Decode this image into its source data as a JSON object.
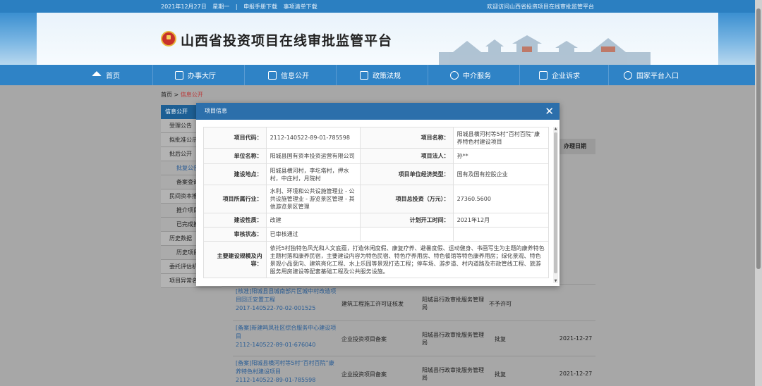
{
  "topbar": {
    "date": "2021年12月27日",
    "weekday": "星期一",
    "separator": "|",
    "manual_download": "申报手册下载",
    "list_download": "事项清单下载",
    "welcome": "欢迎访问山西省投资项目在线审批监管平台"
  },
  "header": {
    "site_title": "山西省投资项目在线审批监管平台"
  },
  "nav": [
    "首页",
    "办事大厅",
    "信息公开",
    "政策法规",
    "中介服务",
    "企业诉求",
    "国家平台入口"
  ],
  "breadcrumb": {
    "home": "首页",
    "arrow": ">",
    "current": "信息公开"
  },
  "sidebar": {
    "head": "信息公开",
    "items": [
      {
        "label": "受理公告",
        "sub": false
      },
      {
        "label": "拟批准公示",
        "sub": false
      },
      {
        "label": "批后公开",
        "sub": false
      },
      {
        "label": "批复公告",
        "sub": true,
        "active": true
      },
      {
        "label": "备案查询",
        "sub": true
      },
      {
        "label": "民间资本推介",
        "sub": false
      },
      {
        "label": "推介项目",
        "sub": true
      },
      {
        "label": "已完成推介",
        "sub": true
      },
      {
        "label": "历史数据",
        "sub": false
      },
      {
        "label": "历史项目",
        "sub": true
      },
      {
        "label": "委托评估机构",
        "sub": false
      },
      {
        "label": "项目异常名录",
        "sub": false
      }
    ]
  },
  "table": {
    "header_date": "办理日期",
    "rows": [
      {
        "name": "[核准]阳城县县城南部片区城中村改造项目回迁安置工程",
        "code": "2017-140522-70-02-001525",
        "matter": "建筑工程施工许可证核发",
        "dept": "阳城县行政审批服务管理局",
        "result": "不予许可",
        "date": ""
      },
      {
        "name": "[备案]新建鸣凤社区综合服务中心建设项目",
        "code": "2112-140522-89-01-676040",
        "matter": "企业投资项目备案",
        "dept": "阳城县行政审批服务管理局",
        "result": "批复",
        "date": "2021-12-27"
      },
      {
        "name": "[备案]阳城县横河村等5村“百村百院”康养特色村建设项目",
        "code": "2112-140522-89-01-785598",
        "matter": "企业投资项目备案",
        "dept": "阳城县行政审批服务管理局",
        "result": "批复",
        "date": "2021-12-27"
      }
    ]
  },
  "modal": {
    "title": "项目信息",
    "close": "✕",
    "fields": {
      "code_k": "项目代码：",
      "code_v": "2112-140522-89-01-785598",
      "name_k": "项目名称：",
      "name_v": "阳城县横河村等5村“百村百院”康养特色村建设项目",
      "unit_k": "单位名称：",
      "unit_v": "阳城县国有资本投资运营有限公司",
      "legal_k": "项目法人：",
      "legal_v": "孙**",
      "site_k": "建设地点：",
      "site_v": "阳城县横河村，李圪塔村，押水村，中庄村，月院村",
      "econ_k": "项目单位经济类型：",
      "econ_v": "国有及国有控股企业",
      "industry_k": "项目所属行业：",
      "industry_v": "水利、环境和公共设施管理业 - 公共设施管理业 - 游览景区管理 - 其他游览景区管理",
      "invest_k": "项目总投资（万元）：",
      "invest_v": "27360.5600",
      "nature_k": "建设性质：",
      "nature_v": "改建",
      "start_k": "计划开工时间：",
      "start_v": "2021年12月",
      "status_k": "审核状态：",
      "status_v": "已审核通过",
      "scope_k": "主要建设规模及内容：",
      "scope_v": "依托5村独特色风光和人文底蕴，打造休闲度假、康复疗养、避暑度假、运动健身、书画写生为主题的康养特色主题村落和康养民宿，主要建设内容为特色民宿、特色疗养用房、特色餐馆等特色康养用房；绿化景观、特色景观小品意向、建筑亮化工程、水上乐园等景观打造工程；停车场、游步道、村内道路及市政管线工程、旅游服务用房建设等配套基础工程及公共服务设施。"
    }
  },
  "colors": {
    "nav": "#2f83c6",
    "modal_header": "#2c6fab",
    "link": "#2a5d95"
  }
}
